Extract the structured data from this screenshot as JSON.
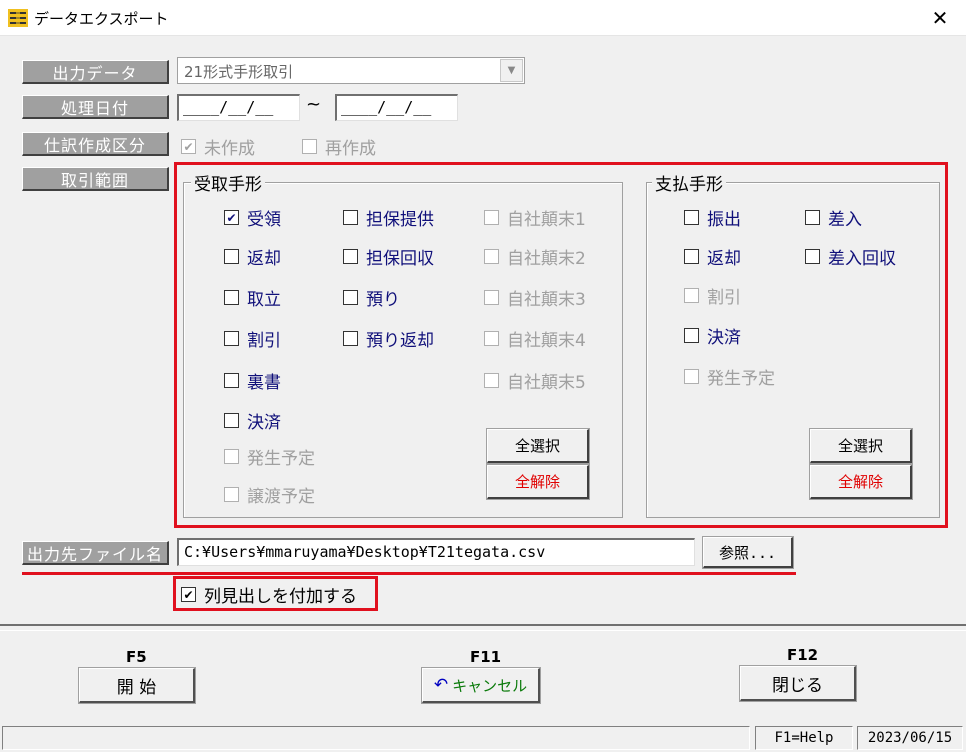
{
  "window": {
    "title": "データエクスポート",
    "close_glyph": "✕"
  },
  "labels": {
    "output_data": "出力データ",
    "process_date": "処理日付",
    "journal_type": "仕訳作成区分",
    "range": "取引範囲",
    "output_file": "出力先ファイル名"
  },
  "output_data": {
    "value": "21形式手形取引"
  },
  "date_range": {
    "from": "____/__/__",
    "to": "____/__/__",
    "separator": "~"
  },
  "journal": {
    "uncreated": "未作成",
    "recreated": "再作成"
  },
  "receivable": {
    "title": "受取手形",
    "col1": [
      {
        "label": "受領",
        "checked": true,
        "enabled": true
      },
      {
        "label": "返却",
        "checked": false,
        "enabled": true
      },
      {
        "label": "取立",
        "checked": false,
        "enabled": true
      },
      {
        "label": "割引",
        "checked": false,
        "enabled": true
      },
      {
        "label": "裏書",
        "checked": false,
        "enabled": true
      },
      {
        "label": "決済",
        "checked": false,
        "enabled": true
      },
      {
        "label": "発生予定",
        "checked": false,
        "enabled": false
      },
      {
        "label": "譲渡予定",
        "checked": false,
        "enabled": false
      }
    ],
    "col2": [
      {
        "label": "担保提供",
        "checked": false,
        "enabled": true
      },
      {
        "label": "担保回収",
        "checked": false,
        "enabled": true
      },
      {
        "label": "預り",
        "checked": false,
        "enabled": true
      },
      {
        "label": "預り返却",
        "checked": false,
        "enabled": true
      }
    ],
    "col3": [
      {
        "label": "自社顛末1",
        "checked": false,
        "enabled": false
      },
      {
        "label": "自社顛末2",
        "checked": false,
        "enabled": false
      },
      {
        "label": "自社顛末3",
        "checked": false,
        "enabled": false
      },
      {
        "label": "自社顛末4",
        "checked": false,
        "enabled": false
      },
      {
        "label": "自社顛末5",
        "checked": false,
        "enabled": false
      }
    ],
    "select_all": "全選択",
    "clear_all": "全解除"
  },
  "payable": {
    "title": "支払手形",
    "col1": [
      {
        "label": "振出",
        "checked": false,
        "enabled": true
      },
      {
        "label": "返却",
        "checked": false,
        "enabled": true
      },
      {
        "label": "割引",
        "checked": false,
        "enabled": false
      },
      {
        "label": "決済",
        "checked": false,
        "enabled": true
      },
      {
        "label": "発生予定",
        "checked": false,
        "enabled": false
      }
    ],
    "col2": [
      {
        "label": "差入",
        "checked": false,
        "enabled": true
      },
      {
        "label": "差入回収",
        "checked": false,
        "enabled": true
      }
    ],
    "select_all": "全選択",
    "clear_all": "全解除"
  },
  "file": {
    "path": "C:¥Users¥mmaruyama¥Desktop¥T21tegata.csv",
    "browse": "参照..."
  },
  "header_option": {
    "label": "列見出しを付加する",
    "checked": true
  },
  "footer": {
    "f5": "F5",
    "start": "開 始",
    "f11": "F11",
    "cancel": "キャンセル",
    "f12": "F12",
    "close": "閉じる"
  },
  "status": {
    "help": "F1=Help",
    "date": "2023/06/15"
  },
  "colors": {
    "accent_red": "#e0101e",
    "label_gray": "#a0a0a0",
    "text_blue": "#10107a"
  }
}
